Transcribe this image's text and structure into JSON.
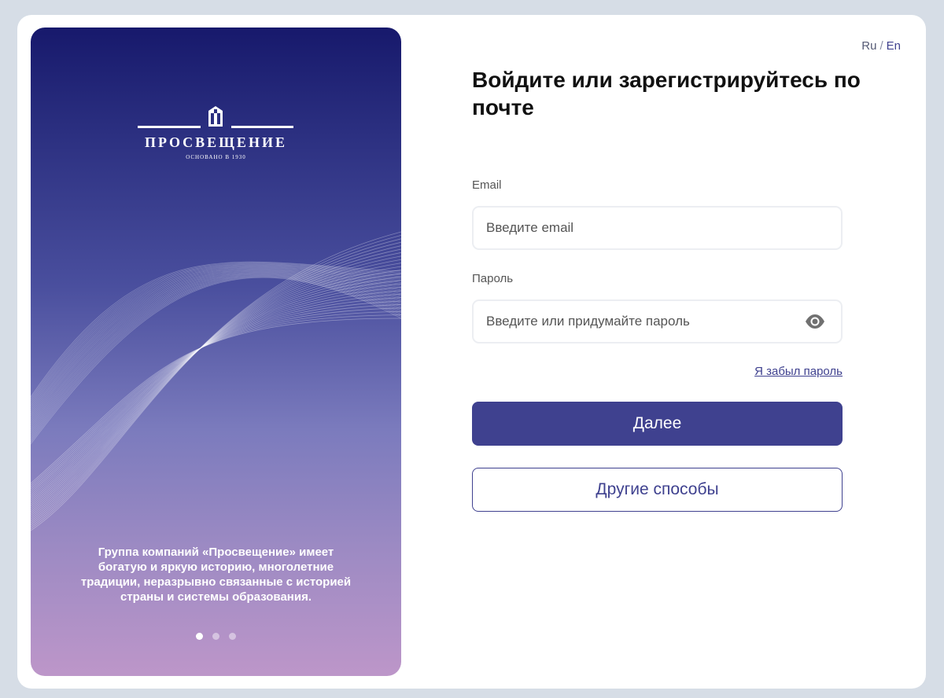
{
  "brand": {
    "name": "ПРОСВЕЩЕНИЕ",
    "tagline": "ОСНОВАНО В 1930"
  },
  "promo": {
    "text": "Группа компаний «Просвещение» имеет богатую и яркую историю, многолетние традиции, неразрывно связанные с историей страны и системы образования.",
    "slides_total": 3,
    "active_slide": 1
  },
  "language": {
    "ru": "Ru",
    "separator": "/",
    "en": "En"
  },
  "form": {
    "title": "Войдите или зарегистрируйтесь по почте",
    "email_label": "Email",
    "email_placeholder": "Введите email",
    "password_label": "Пароль",
    "password_placeholder": "Введите или придумайте пароль",
    "forgot_label": "Я забыл пароль",
    "submit_label": "Далее",
    "other_label": "Другие способы"
  },
  "icons": {
    "eye": "eye-icon",
    "logo": "building-logo-icon"
  },
  "colors": {
    "accent": "#3f418f",
    "page_background": "#d6dde6",
    "promo_top": "#17196c",
    "promo_bottom": "#bd96c9"
  }
}
